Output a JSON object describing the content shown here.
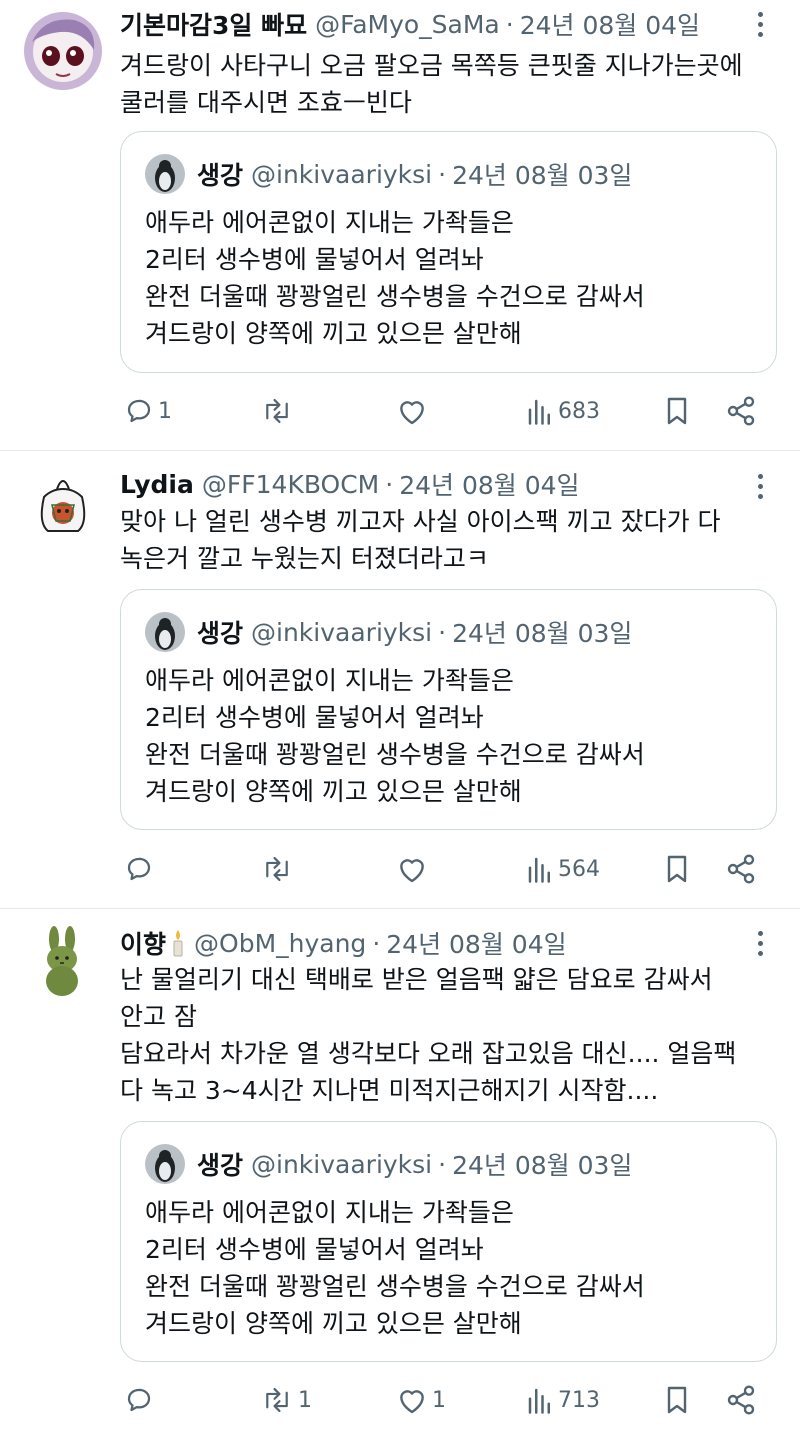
{
  "colors": {
    "text": "#0f1419",
    "muted": "#536471",
    "border": "#cfd9de",
    "divider": "#e6e9ec"
  },
  "quoted": {
    "name": "생강",
    "handle": "@inkivaariyksi",
    "date": "24년 08월 03일",
    "lines": [
      "애두라 에어콘없이 지내는 가좍들은",
      "2리터 생수병에 물넣어서 얼려놔",
      "완전 더울때 꽝꽝얼린 생수병을 수건으로 감싸서",
      "겨드랑이 양쪽에 끼고 있으믄 살만해"
    ]
  },
  "posts": [
    {
      "name": "기본마감3일 빠묘",
      "handle": "@FaMyo_SaMa",
      "date": "24년 08월 04일",
      "lines": [
        "겨드랑이 사타구니 오금 팔오금 목쪽등 큰핏줄 지나가는곳에",
        "쿨러를 대주시면 조효ㅡ빈다"
      ],
      "replies": "1",
      "reposts": "",
      "likes": "",
      "views": "683"
    },
    {
      "name": "Lydia",
      "handle": "@FF14KBOCM",
      "date": "24년 08월 04일",
      "lines": [
        "맞아 나 얼린 생수병 끼고자 사실 아이스팩 끼고 잤다가 다",
        "녹은거 깔고 누웠는지 터졌더라고ㅋ"
      ],
      "replies": "",
      "reposts": "",
      "likes": "",
      "views": "564"
    },
    {
      "name": "이향",
      "handle": "@ObM_hyang",
      "date": "24년 08월 04일",
      "lines": [
        "난 물얼리기 대신 택배로 받은 얼음팩 얇은 담요로 감싸서",
        "안고 잠",
        "담요라서 차가운 열 생각보다 오래 잡고있음 대신.... 얼음팩",
        "다 녹고 3~4시간 지나면 미적지근해지기 시작함...."
      ],
      "replies": "",
      "reposts": "1",
      "likes": "1",
      "views": "713"
    }
  ],
  "icons": {
    "reply": "reply-icon",
    "repost": "repost-icon",
    "like": "heart-icon",
    "views": "views-icon",
    "bookmark": "bookmark-icon",
    "share": "share-icon",
    "more": "more-icon",
    "candle": "candle-icon"
  }
}
